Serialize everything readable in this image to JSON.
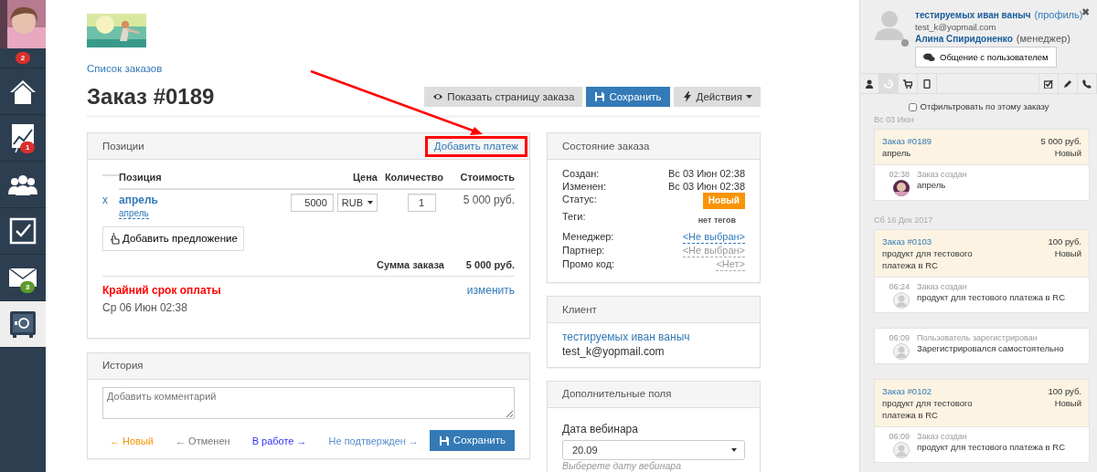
{
  "sidebar": {
    "avatar_badge": {
      "text": "2",
      "color": "#d9302c"
    },
    "items": [
      {
        "selected": false
      },
      {
        "selected": false,
        "badge": {
          "text": "1",
          "color": "#d9302c"
        }
      },
      {
        "selected": false
      },
      {
        "selected": false
      },
      {
        "selected": false,
        "badge": {
          "text": "3",
          "color": "#5b9a2c"
        }
      },
      {
        "selected": true
      }
    ]
  },
  "header": {
    "breadcrumb": "Список заказов",
    "title": "Заказ #0189",
    "buttons": [
      {
        "label": "Показать страницу заказа",
        "kind": "default"
      },
      {
        "label": "Сохранить",
        "kind": "primary"
      },
      {
        "label": "Действия",
        "kind": "dropdown"
      }
    ]
  },
  "positions": {
    "title": "Позиции",
    "action": "Добавить платеж",
    "action_highlighted": true,
    "columns": [
      "Позиция",
      "Цена",
      "Количество",
      "Стоимость"
    ],
    "rows": [
      {
        "remove": "x",
        "name": "апрель",
        "subtitle": "апрель",
        "price": "5000",
        "currency": "RUB",
        "quantity": "1",
        "cost": "5 000 руб."
      }
    ],
    "add_offer": "Добавить предложение",
    "total_label": "Сумма заказа",
    "total_value": "5 000 руб.",
    "deadline_label": "Крайний срок оплаты",
    "deadline_edit": "изменить",
    "deadline_value": "Ср 06 Июн 02:38"
  },
  "history": {
    "title": "История",
    "comment_placeholder": "Добавить комментарий",
    "statuses": [
      {
        "label": "Новый",
        "arrow_before": "←",
        "color": "#f89406"
      },
      {
        "label": "Отменен",
        "arrow_before": "←",
        "color": "#777777"
      },
      {
        "label": "В работе",
        "arrow_after": "→",
        "color": "#3333ff"
      },
      {
        "label": "Не подтвержден",
        "arrow_after": "→",
        "color": "#5b8fcf"
      }
    ],
    "save": "Сохранить"
  },
  "order_state": {
    "title": "Состояние заказа",
    "rows": [
      {
        "label": "Создан:",
        "value": "Вс 03 Июн 02:38",
        "kind": "text"
      },
      {
        "label": "Изменен:",
        "value": "Вс 03 Июн 02:38",
        "kind": "text"
      },
      {
        "label": "Статус:",
        "value": "Новый",
        "kind": "badge"
      },
      {
        "label": "Теги:",
        "value": "нет тегов",
        "kind": "note"
      }
    ],
    "links": [
      {
        "label": "Менеджер:",
        "value": "<Не выбран>",
        "kind": "link"
      },
      {
        "label": "Партнер:",
        "value": "<Не выбран>",
        "kind": "muted"
      },
      {
        "label": "Промо код:",
        "value": "<Нет>",
        "kind": "muted"
      }
    ]
  },
  "client": {
    "title": "Клиент",
    "name": "тестируемых иван ваныч",
    "email": "test_k@yopmail.com"
  },
  "extra_fields": {
    "title": "Дополнительные поля",
    "label": "Дата вебинара",
    "value": "20.09",
    "help": "Выберете дату вебинара"
  },
  "user_panel": {
    "name": "тестируемых иван ваныч",
    "profile": "(профиль)",
    "email": "test_k@yopmail.com",
    "manager": "Алина Спиридоненко",
    "manager_role": "(менеджер)",
    "chat": "Общение с пользователем",
    "close": "✖",
    "tabs": [
      {
        "selected": false
      },
      {
        "selected": true
      },
      {
        "selected": false
      },
      {
        "selected": false
      },
      {
        "selected": false
      },
      {
        "selected": false
      },
      {
        "selected": false
      }
    ],
    "filter": {
      "label": "Отфильтровать по этому заказу",
      "checked": false
    },
    "groups": [
      {
        "date": "Вс 03 Июн",
        "cards": [
          {
            "order": {
              "title": "Заказ #0189",
              "amount": "5 000 руб.",
              "product": "апрель",
              "status": "Новый"
            },
            "events": [
              {
                "time": "02:38",
                "title": "Заказ создан",
                "text": "апрель"
              }
            ]
          }
        ]
      },
      {
        "date": "Сб 16 Дек 2017",
        "cards": [
          {
            "order": {
              "title": "Заказ #0103",
              "amount": "100 руб.",
              "product": "продукт для тестового платежа в RC",
              "status": "Новый"
            },
            "events": [
              {
                "time": "06:24",
                "title": "Заказ создан",
                "text": "продукт для тестового платежа в RC",
                "kind": "generic"
              }
            ]
          },
          {
            "events": [
              {
                "time": "06:09",
                "title": "Пользователь зарегистрирован",
                "text": "Зарегистрировался самостоятельно",
                "kind": "generic"
              }
            ]
          },
          {
            "order": {
              "title": "Заказ #0102",
              "amount": "100 руб.",
              "product": "продукт для тестового платежа в RC",
              "status": "Новый"
            },
            "events": [
              {
                "time": "06:09",
                "title": "Заказ создан",
                "text": "продукт для тестового платежа в RC",
                "kind": "generic"
              }
            ]
          }
        ]
      }
    ]
  }
}
